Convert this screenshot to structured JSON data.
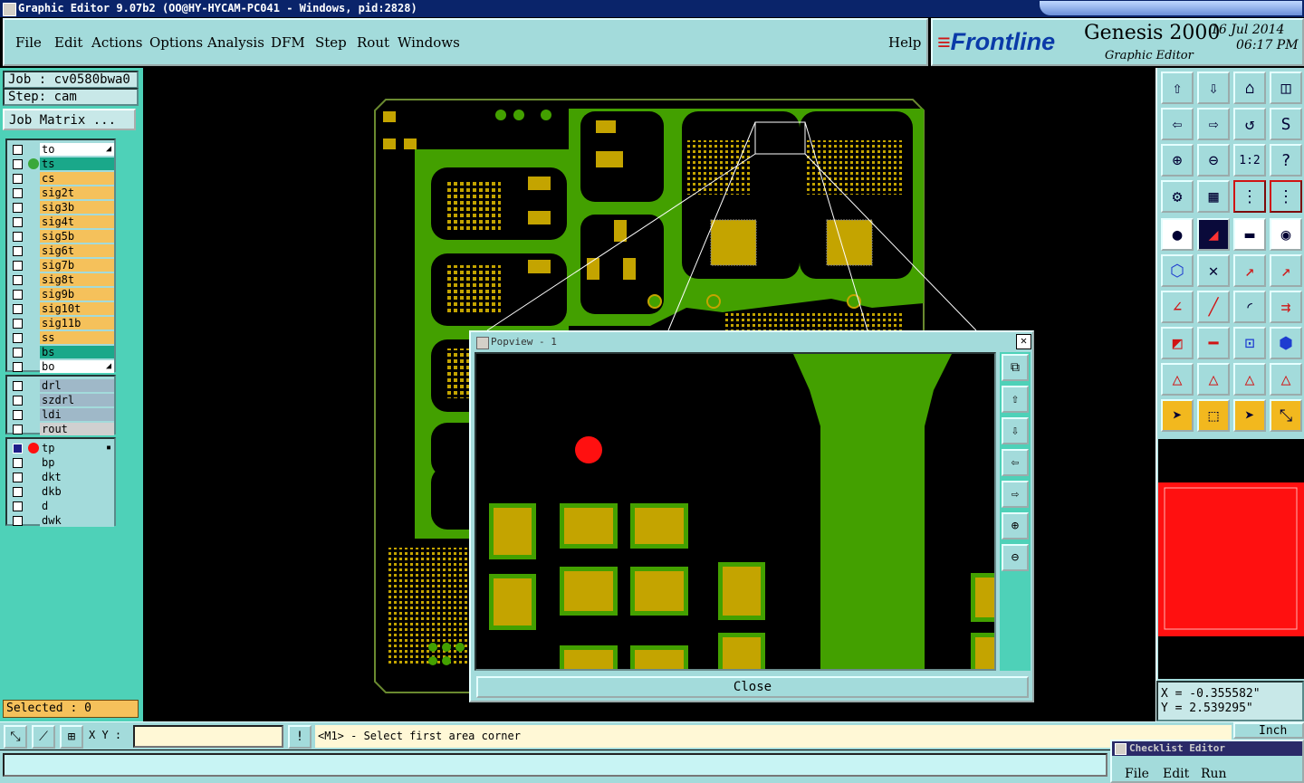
{
  "window": {
    "title": "Graphic Editor 9.07b2 (OO@HY-HYCAM-PC041 - Windows, pid:2828)"
  },
  "menubar": {
    "items": [
      "File",
      "Edit",
      "Actions",
      "Options",
      "Analysis",
      "DFM",
      "Step",
      "Rout",
      "Windows"
    ],
    "help": "Help"
  },
  "brand": {
    "logo": "Frontline",
    "product": "Genesis 2000",
    "subtitle": "Graphic Editor",
    "date": "16 Jul 2014",
    "time": "06:17 PM"
  },
  "job": {
    "job_label": "Job : cv0580bwa0",
    "step_label": "Step: cam",
    "matrix_button": "Job Matrix ..."
  },
  "layers": {
    "group1": [
      {
        "name": "to",
        "color": "#ffffff",
        "arrow": true
      },
      {
        "name": "ts",
        "color": "#1aa88a",
        "dot": "#3aa83a"
      },
      {
        "name": "cs",
        "color": "#f5c15b"
      },
      {
        "name": "sig2t",
        "color": "#f5c15b"
      },
      {
        "name": "sig3b",
        "color": "#f5c15b"
      },
      {
        "name": "sig4t",
        "color": "#f5c15b"
      },
      {
        "name": "sig5b",
        "color": "#f5c15b"
      },
      {
        "name": "sig6t",
        "color": "#f5c15b"
      },
      {
        "name": "sig7b",
        "color": "#f5c15b"
      },
      {
        "name": "sig8t",
        "color": "#f5c15b"
      },
      {
        "name": "sig9b",
        "color": "#f5c15b"
      },
      {
        "name": "sig10t",
        "color": "#f5c15b"
      },
      {
        "name": "sig11b",
        "color": "#f5c15b"
      },
      {
        "name": "ss",
        "color": "#f5c15b"
      },
      {
        "name": "bs",
        "color": "#1aa88a"
      },
      {
        "name": "bo",
        "color": "#ffffff",
        "arrow": true
      }
    ],
    "group2": [
      {
        "name": "drl",
        "color": "#9fb8c8"
      },
      {
        "name": "szdrl",
        "color": "#9fb8c8"
      },
      {
        "name": "ldi",
        "color": "#9fb8c8"
      },
      {
        "name": "rout",
        "color": "#d0d0d0"
      }
    ],
    "group3": [
      {
        "name": "tp",
        "color": "#a3dbdb",
        "dot": "#ff1010",
        "checked": true,
        "icon": true
      },
      {
        "name": "bp",
        "color": "#a3dbdb"
      },
      {
        "name": "dkt",
        "color": "#a3dbdb"
      },
      {
        "name": "dkb",
        "color": "#a3dbdb"
      },
      {
        "name": "d",
        "color": "#a3dbdb"
      },
      {
        "name": "dwk",
        "color": "#a3dbdb"
      }
    ]
  },
  "selected": "Selected : 0",
  "coords": {
    "x": "X = -0.355582\"",
    "y": "Y = 2.539295\""
  },
  "status": {
    "xy_label": "X Y :",
    "xy_value": "",
    "message": "<M1> - Select first area corner",
    "units": "Inch"
  },
  "popview": {
    "title": "Popview - 1",
    "close": "Close"
  },
  "checklist": {
    "title": "Checklist Editor",
    "menu": [
      "File",
      "Edit",
      "Run"
    ]
  },
  "colors": {
    "board_green": "#43a000",
    "pad_gold": "#c4a400",
    "highlight_red": "#ff1010",
    "panel_cyan": "#a3dbdb"
  }
}
